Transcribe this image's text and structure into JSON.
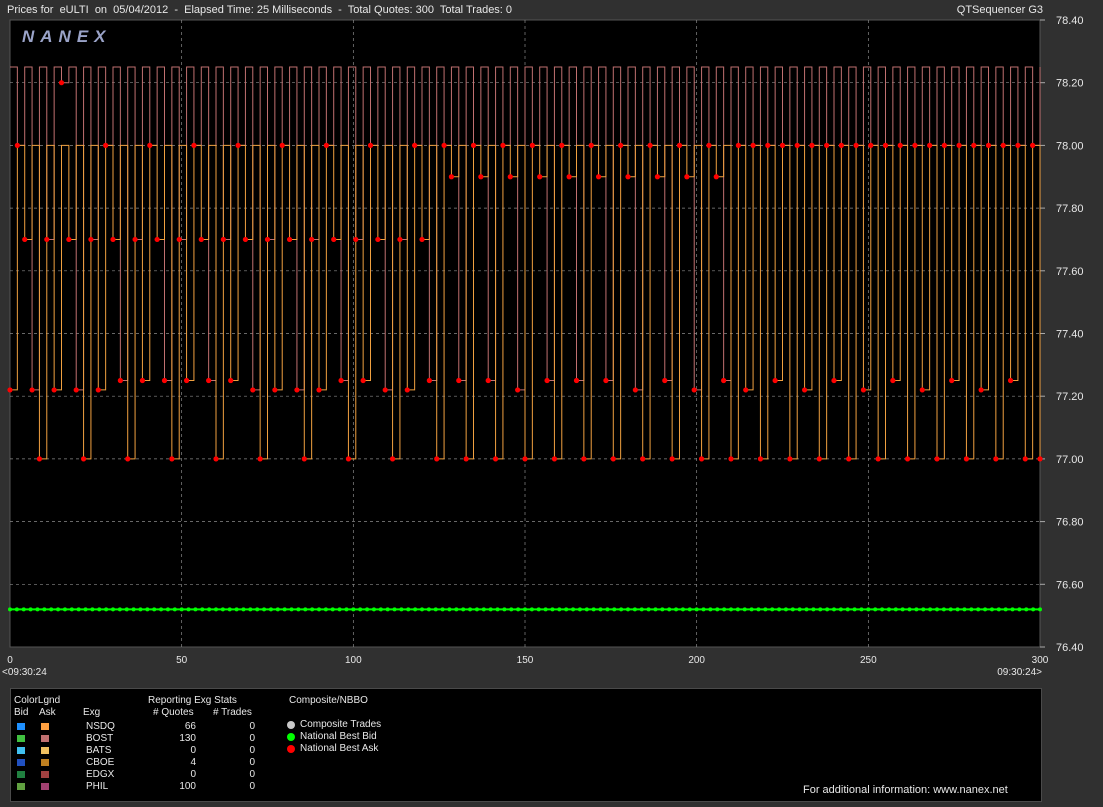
{
  "header": {
    "title": "Prices for  eULTI  on  05/04/2012  -  Elapsed Time: 25 Milliseconds  -  Total Quotes: 300  Total Trades: 0",
    "app": "QTSequencer G3",
    "logo": "NANEX"
  },
  "chart_data": {
    "type": "line",
    "xlim": [
      0,
      300
    ],
    "ylim": [
      76.4,
      78.4
    ],
    "x_ticks": [
      "0",
      "50",
      "100",
      "150",
      "200",
      "250",
      "300"
    ],
    "y_ticks": [
      "78.40",
      "78.20",
      "78.00",
      "77.80",
      "77.60",
      "77.40",
      "77.20",
      "77.00",
      "76.80",
      "76.60",
      "76.40"
    ],
    "x_start_label": "<09:30:24",
    "x_end_label": "09:30:24>",
    "grid": true,
    "series": [
      {
        "name": "National Best Bid",
        "color": "#00ff00",
        "values": [
          76.52
        ]
      },
      {
        "name": "National Best Ask",
        "color": "#ff0000",
        "values": [
          77.22,
          78.0,
          77.7,
          77.22,
          77.0,
          77.7,
          77.22,
          78.2,
          77.7,
          77.22,
          77.0,
          77.7,
          77.22,
          78.0,
          77.7,
          77.25,
          77.0,
          77.7,
          77.25,
          78.0,
          77.7,
          77.25,
          77.0,
          77.7,
          77.25,
          78.0,
          77.7,
          77.25,
          77.0,
          77.7,
          77.25,
          78.0,
          77.7,
          77.22,
          77.0,
          77.7,
          77.22,
          78.0,
          77.7,
          77.22,
          77.0,
          77.7,
          77.22,
          78.0,
          77.7,
          77.25,
          77.0,
          77.7,
          77.25,
          78.0,
          77.7,
          77.22,
          77.0,
          77.7,
          77.22,
          78.0,
          77.7,
          77.25,
          77.0,
          78.0,
          77.9,
          77.25,
          77.0,
          78.0,
          77.9,
          77.25,
          77.0,
          78.0,
          77.9,
          77.22,
          77.0,
          78.0,
          77.9,
          77.25,
          77.0,
          78.0,
          77.9,
          77.25,
          77.0,
          78.0,
          77.9,
          77.25,
          77.0,
          78.0,
          77.9,
          77.22,
          77.0,
          78.0,
          77.9,
          77.25,
          77.0,
          78.0,
          77.9,
          77.22,
          77.0,
          78.0,
          77.9,
          77.25,
          77.0,
          78.0,
          77.22,
          78.0,
          77.0,
          78.0,
          77.25,
          78.0,
          77.0,
          78.0,
          77.22,
          78.0,
          77.0,
          78.0,
          77.25,
          78.0,
          77.0,
          78.0,
          77.22,
          78.0,
          77.0,
          78.0,
          77.25,
          78.0,
          77.0,
          78.0,
          77.22,
          78.0,
          77.0,
          78.0,
          77.25,
          78.0,
          77.0,
          78.0,
          77.22,
          78.0,
          77.0,
          78.0,
          77.25,
          78.0,
          77.0,
          78.0,
          77.0
        ]
      },
      {
        "name": "NSDQ Ask",
        "color": "#f0a040",
        "values": [
          78.0
        ]
      },
      {
        "name": "BOST Ask",
        "color": "#c07070",
        "values": [
          78.25
        ]
      }
    ]
  },
  "legend": {
    "colorlgnd": "ColorLgnd",
    "bid": "Bid",
    "ask": "Ask",
    "exg_col": "Exg",
    "stats_title": "Reporting Exg Stats",
    "quotes_col": "# Quotes",
    "trades_col": "# Trades",
    "composite_title": "Composite/NBBO",
    "composite_trades": "Composite Trades",
    "national_best_bid": "National Best Bid",
    "national_best_ask": "National Best Ask",
    "footer": "For additional information: www.nanex.net",
    "rows": [
      {
        "exg": "NSDQ",
        "quotes": "66",
        "trades": "0",
        "bid_color": "#1e90ff",
        "ask_color": "#ffa040"
      },
      {
        "exg": "BOST",
        "quotes": "130",
        "trades": "0",
        "bid_color": "#40c040",
        "ask_color": "#c07070"
      },
      {
        "exg": "BATS",
        "quotes": "0",
        "trades": "0",
        "bid_color": "#40c0f0",
        "ask_color": "#f0c060"
      },
      {
        "exg": "CBOE",
        "quotes": "4",
        "trades": "0",
        "bid_color": "#2050c0",
        "ask_color": "#c08020"
      },
      {
        "exg": "EDGX",
        "quotes": "0",
        "trades": "0",
        "bid_color": "#208040",
        "ask_color": "#a04040"
      },
      {
        "exg": "PHIL",
        "quotes": "100",
        "trades": "0",
        "bid_color": "#60a040",
        "ask_color": "#a04070"
      }
    ]
  }
}
